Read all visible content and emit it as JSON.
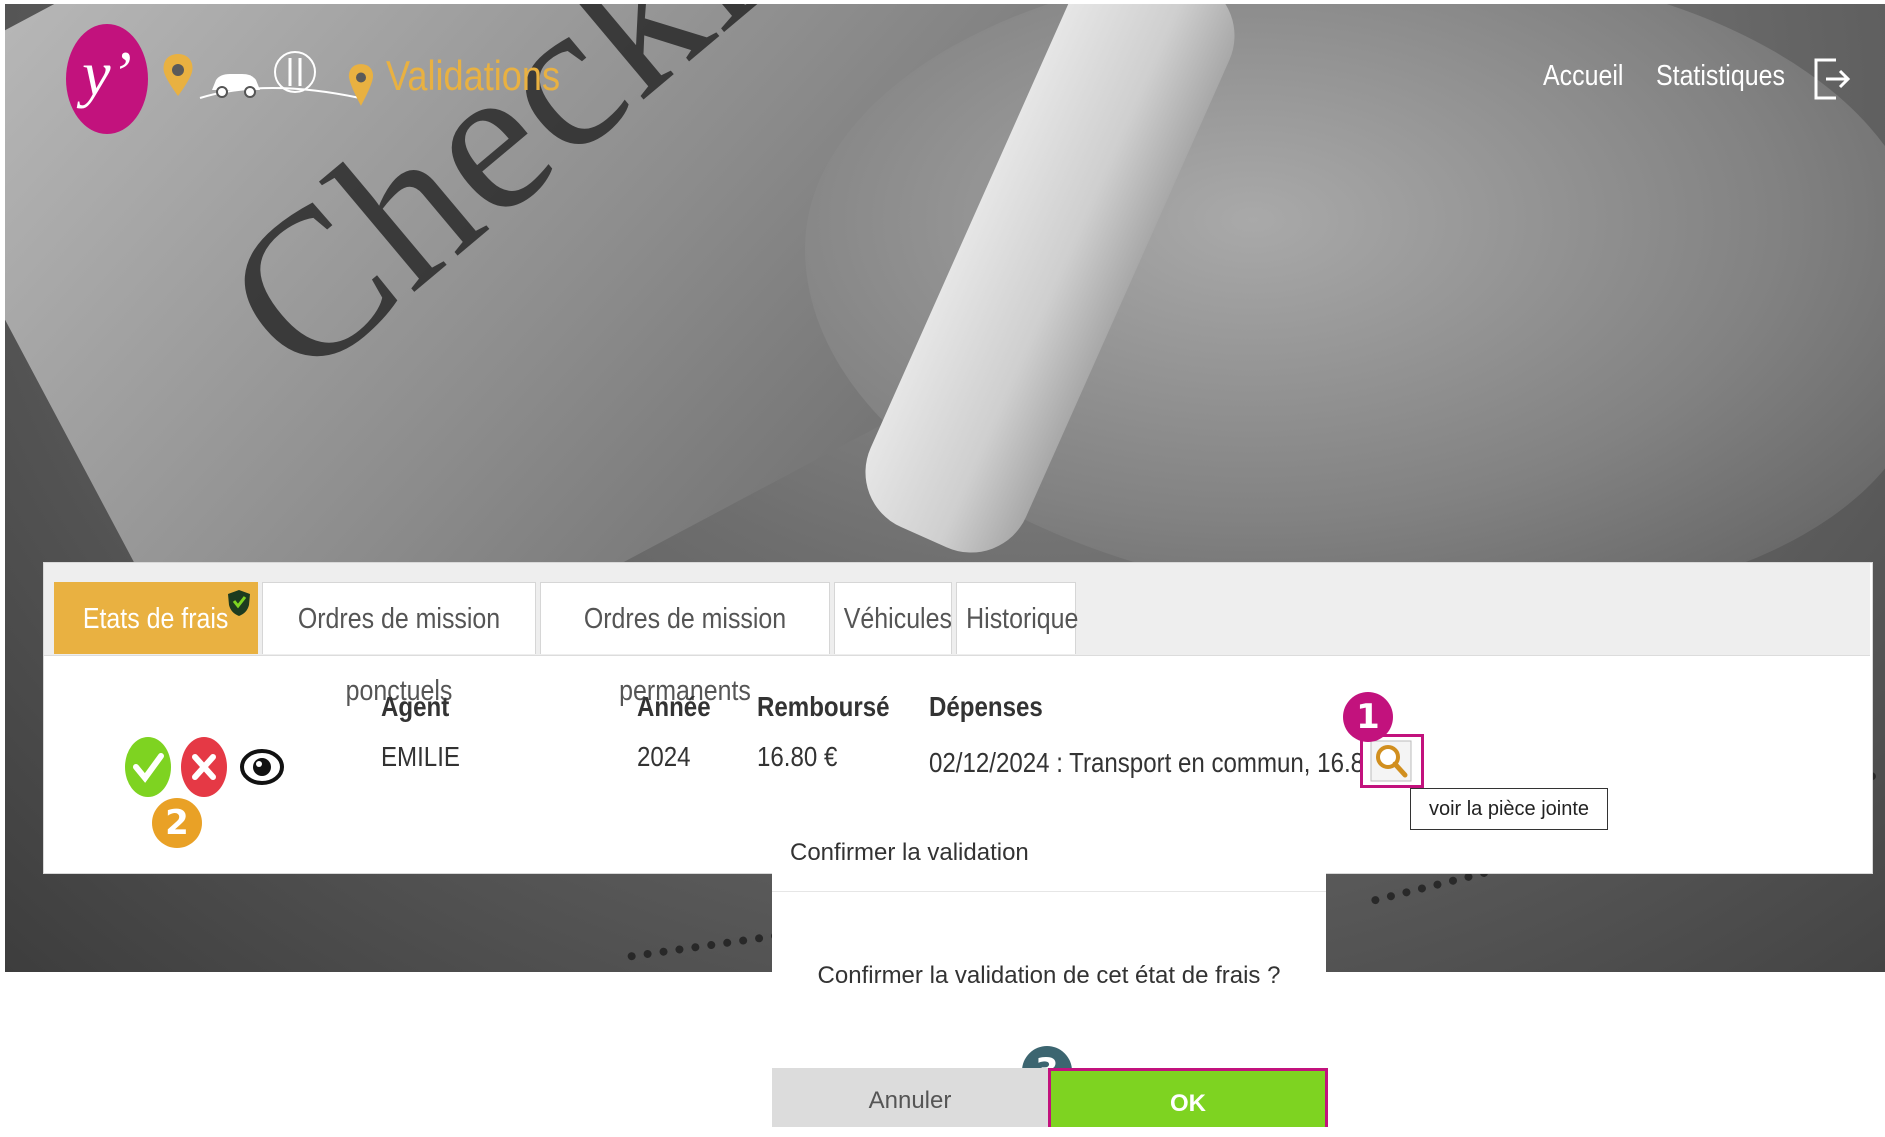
{
  "header": {
    "logo_text": "y’",
    "page_title": "Validations",
    "nav": {
      "home": "Accueil",
      "stats": "Statistiques"
    },
    "icons": [
      "map-pin-icon",
      "car-icon",
      "cutlery-icon",
      "map-pin-icon",
      "logout-icon"
    ]
  },
  "tabs": [
    {
      "label": "Etats de frais",
      "active": true
    },
    {
      "label": "Ordres de mission ponctuels",
      "active": false
    },
    {
      "label": "Ordres de mission permanents",
      "active": false
    },
    {
      "label": "Véhicules",
      "active": false
    },
    {
      "label": "Historique",
      "active": false
    }
  ],
  "table": {
    "headers": {
      "agent": "Agent",
      "year": "Année",
      "reimbursed": "Remboursé",
      "expenses": "Dépenses"
    },
    "row": {
      "agent": "EMILIE",
      "year": "2024",
      "reimbursed": "16.80 €",
      "expenses": "02/12/2024 : Transport en commun, 16.80 €"
    },
    "actions": [
      "validate-icon",
      "reject-icon",
      "view-icon"
    ]
  },
  "tooltip": {
    "text": "voir la pièce jointe"
  },
  "markers": {
    "m1": "1",
    "m2": "2",
    "m3": "3"
  },
  "modal": {
    "title": "Confirmer la validation",
    "message": "Confirmer la validation de cet état de frais ?",
    "cancel": "Annuler",
    "ok": "OK"
  },
  "colors": {
    "accent": "#e9b141",
    "brand": "#c2127d",
    "validate": "#7ed321",
    "reject": "#e53945",
    "marker_orange": "#e9a126",
    "marker_dark": "#3c6570"
  }
}
